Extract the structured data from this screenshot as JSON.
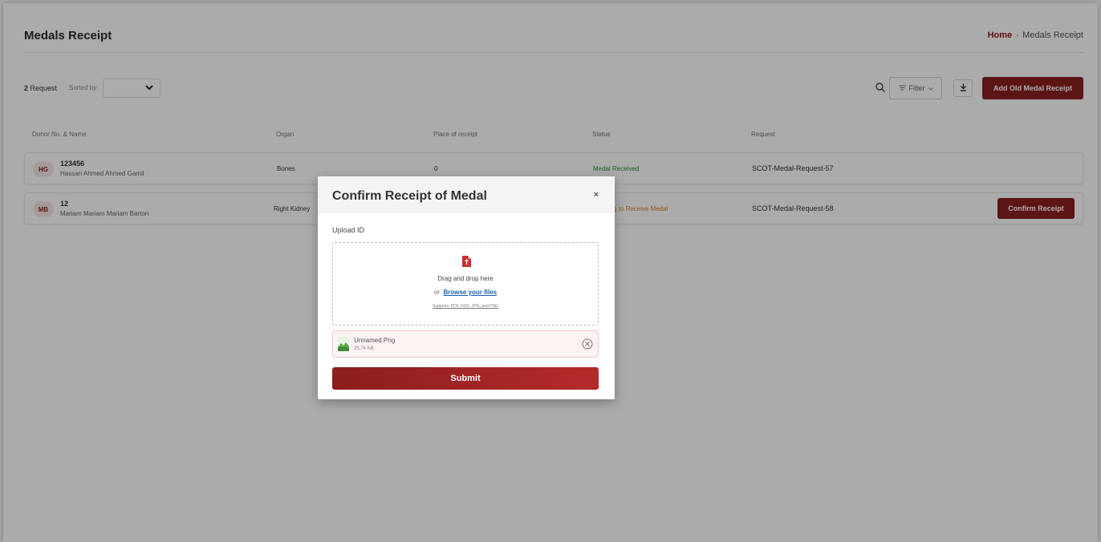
{
  "header": {
    "title": "Medals Receipt",
    "breadcrumb": {
      "home": "Home",
      "separator": "›",
      "current": "Medals Receipt"
    }
  },
  "toolbar": {
    "request_count": "2",
    "request_label": "Request",
    "sorted_by_label": "Sorted by:",
    "filter_label": "Filter",
    "add_button_label": "Add Old Medal Receipt"
  },
  "table": {
    "headers": [
      "Donor No. & Name",
      "Organ",
      "Place of receipt",
      "Status",
      "Request"
    ],
    "rows": [
      {
        "initials": "HG",
        "donor_no": "123456",
        "donor_name": "Hassan Ahmed Ahmed Gamil",
        "organ": "Bones",
        "place": "0",
        "status": "Medal Received",
        "request": "SCOT-Medal-Request-57"
      },
      {
        "initials": "MB",
        "donor_no": "12",
        "donor_name": "Mariam Mariam Mariam Barton",
        "organ": "Right Kidney",
        "place": "",
        "status": "g to Receive Medal",
        "request": "SCOT-Medal-Request-58",
        "action_label": "Confirm Receipt"
      }
    ]
  },
  "modal": {
    "title": "Confirm Receipt of Medal",
    "close_label": "×",
    "upload_label": "Upload ID",
    "drag_text": "Drag and drop here",
    "or_text": "or",
    "browse_text": "Browse your files",
    "supports_text": "Supports: PDF, DOC, JPG, and PNG",
    "file": {
      "name": "Unnamed.Png",
      "size": "25.74 KB"
    },
    "submit_label": "Submit"
  },
  "colors": {
    "brand": "#8b1e1e",
    "status_received": "#2e8b2e",
    "status_waiting": "#d48a1a",
    "link": "#1a5fb4"
  }
}
